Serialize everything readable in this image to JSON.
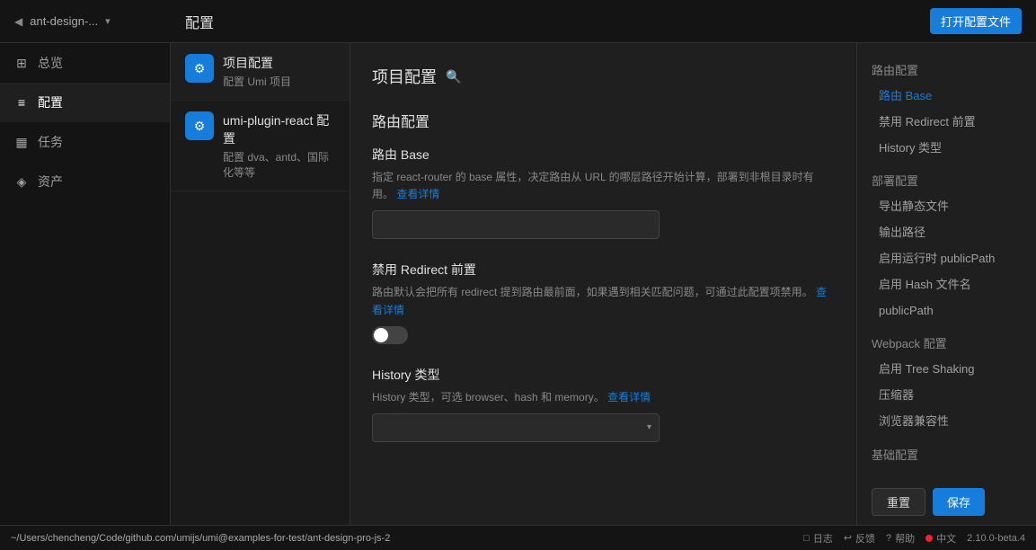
{
  "topbar": {
    "back_icon": "◀",
    "project_name": "ant-design-...",
    "dropdown_icon": "▾",
    "page_title": "配置",
    "open_config_btn": "打开配置文件"
  },
  "sidebar": {
    "items": [
      {
        "id": "overview",
        "icon": "⊞",
        "label": "总览",
        "active": false
      },
      {
        "id": "config",
        "icon": "≡",
        "label": "配置",
        "active": true
      },
      {
        "id": "tasks",
        "icon": "▦",
        "label": "任务",
        "active": false
      },
      {
        "id": "assets",
        "icon": "◈",
        "label": "资产",
        "active": false
      }
    ]
  },
  "sidebar2": {
    "items": [
      {
        "id": "project-config",
        "icon": "⚙",
        "title": "项目配置",
        "sub": "配置 Umi 项目",
        "active": true
      },
      {
        "id": "plugin-config",
        "icon": "⚙",
        "title": "umi-plugin-react 配置",
        "sub": "配置 dva、antd、国际化等等",
        "active": false
      }
    ]
  },
  "content": {
    "header_title": "项目配置",
    "section_routing": "路由配置",
    "fields": [
      {
        "id": "route-base",
        "title": "路由 Base",
        "desc": "指定 react-router 的 base 属性，决定路由从 URL 的哪层路径开始计算，部署到非根目录时有用。",
        "link_text": "查看详情",
        "type": "text",
        "value": ""
      },
      {
        "id": "disable-redirect",
        "title": "禁用 Redirect 前置",
        "desc": "路由默认会把所有 redirect 提到路由最前面，如果遇到相关匹配问题，可通过此配置项禁用。",
        "link_text": "查看详情",
        "type": "toggle",
        "value": false
      },
      {
        "id": "history-type",
        "title": "History 类型",
        "desc": "History 类型，可选 browser、hash 和 memory。",
        "link_text": "查看详情",
        "type": "select",
        "value": ""
      }
    ]
  },
  "right_nav": {
    "sections": [
      {
        "group": "路由配置",
        "items": [
          "路由 Base",
          "禁用 Redirect 前置",
          "History 类型"
        ]
      },
      {
        "group": "部署配置",
        "items": [
          "导出静态文件",
          "输出路径",
          "启用运行时 publicPath",
          "启用 Hash 文件名",
          "publicPath"
        ]
      },
      {
        "group": "Webpack 配置",
        "items": [
          "启用 Tree Shaking",
          "压缩器",
          "浏览器兼容性"
        ]
      },
      {
        "group": "基础配置",
        "items": []
      }
    ]
  },
  "footer": {
    "reset_btn": "重置",
    "save_btn": "保存"
  },
  "bottombar": {
    "path": "~/Users/chencheng/Code/github.com/umijs/umi@examples-for-test/ant-design-pro-js-2",
    "log_label": "日志",
    "feedback_label": "反馈",
    "help_label": "帮助",
    "lang_label": "中文",
    "version_label": "2.10.0-beta.4",
    "dot_color": "#f5222d"
  }
}
